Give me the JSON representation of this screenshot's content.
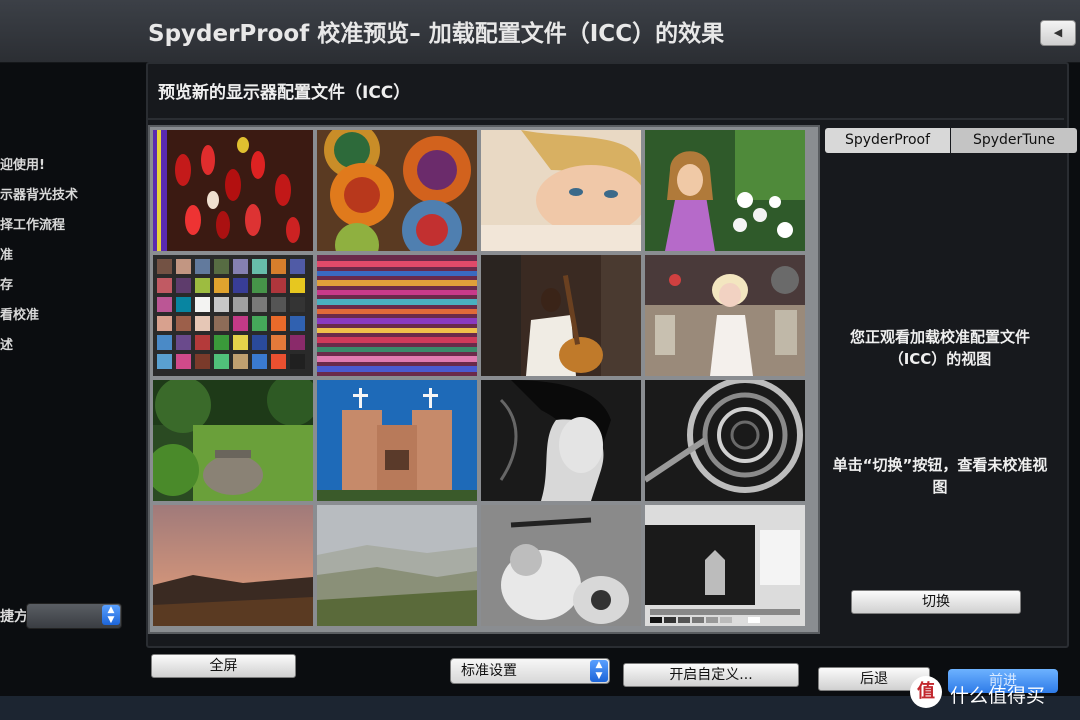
{
  "window": {
    "title": "SpyderProof 校准预览– 加载配置文件（ICC）的效果",
    "back_button": "◀"
  },
  "sidebar": {
    "items": [
      {
        "label": "迎使用!"
      },
      {
        "label": "示器背光技术"
      },
      {
        "label": "择工作流程"
      },
      {
        "label": "准"
      },
      {
        "label": "存"
      },
      {
        "label": "看校准"
      },
      {
        "label": "述"
      }
    ],
    "shortcut_label": "捷方式:"
  },
  "panel": {
    "title": "预览新的显示器配置文件（ICC）",
    "tabs": [
      "SpyderProof",
      "SpyderTune"
    ],
    "info_text": "您正观看加载校准配置文件（ICC）的视图",
    "hint_text": "单击“切换”按钮，查看未校准视图",
    "switch_button": "切换"
  },
  "footer": {
    "fullscreen_button": "全屏",
    "preset_select": "标准设置",
    "custom_button": "开启自定义...",
    "back_button": "后退",
    "next_button": "前进"
  },
  "watermark": {
    "logo_text": "值",
    "text": "什么值得买"
  },
  "colors": {
    "accent": "#2e7be8",
    "panel_bg": "#17191d",
    "titlebar": "#34373d"
  },
  "grid": {
    "images": [
      {
        "name": "chili-peppers"
      },
      {
        "name": "painted-plates"
      },
      {
        "name": "blonde-woman-portrait"
      },
      {
        "name": "girl-with-flowers"
      },
      {
        "name": "color-checker-chart"
      },
      {
        "name": "striped-textiles"
      },
      {
        "name": "guitar-player"
      },
      {
        "name": "marilyn-collage"
      },
      {
        "name": "garden-urn"
      },
      {
        "name": "adobe-church"
      },
      {
        "name": "bw-woman-profile"
      },
      {
        "name": "bw-spiral-staircase"
      },
      {
        "name": "sunset-landscape"
      },
      {
        "name": "hazy-hills"
      },
      {
        "name": "bw-scooter"
      },
      {
        "name": "bw-test-target"
      }
    ]
  }
}
